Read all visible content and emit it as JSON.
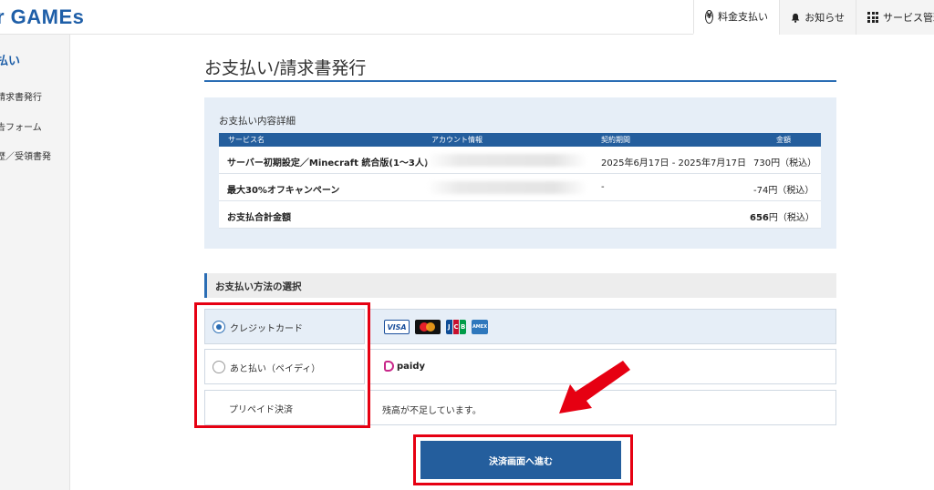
{
  "header": {
    "logo": "r GAMEs",
    "nav": [
      {
        "label": "料金支払い",
        "icon": "yen-icon"
      },
      {
        "label": "お知らせ",
        "icon": "bell-icon"
      },
      {
        "label": "サービス管理",
        "icon": "grid-icon"
      }
    ]
  },
  "sidebar": {
    "title": "払い",
    "items": [
      "請求書発行",
      "告フォーム",
      "歴／受領書発"
    ]
  },
  "main": {
    "title": "お支払い/請求書発行",
    "detail": {
      "heading": "お支払い内容詳細",
      "columns": [
        "サービス名",
        "アカウント情報",
        "契約期間",
        "金額"
      ],
      "rows": [
        {
          "service": "サーバー初期設定／Minecraft 統合版(1〜3人)",
          "period": "2025年6月17日 - 2025年7月17日",
          "amount": "730円（税込）"
        },
        {
          "service": "最大30%オフキャンペーン",
          "period": "-",
          "amount": "-74円（税込）"
        }
      ],
      "total_label": "お支払合計金額",
      "total_value": "656",
      "total_suffix": "円（税込）"
    },
    "method": {
      "heading": "お支払い方法の選択",
      "options": [
        {
          "label": "クレジットカード",
          "selected": true
        },
        {
          "label": "あと払い（ペイディ）",
          "selected": false,
          "brand": "paidy"
        },
        {
          "label": "プリペイド決済",
          "desc": "残高が不足しています。"
        }
      ],
      "cards": {
        "visa": "VISA",
        "jcb": [
          "J",
          "C",
          "B"
        ],
        "amex": "AMEX"
      }
    },
    "proceed_label": "決済画面へ進む"
  },
  "colors": {
    "accent": "#245e9d",
    "highlight": "#e60012",
    "panel": "#e6eef7"
  }
}
